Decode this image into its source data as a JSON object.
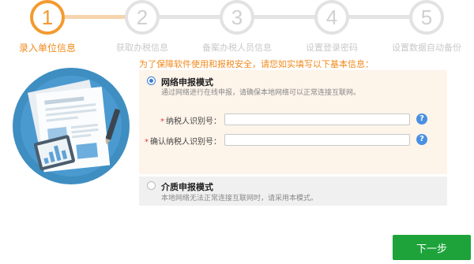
{
  "steps": [
    {
      "number": "1",
      "label": "录入单位信息"
    },
    {
      "number": "2",
      "label": "获取办税信息"
    },
    {
      "number": "3",
      "label": "备案办税人员信息"
    },
    {
      "number": "4",
      "label": "设置登录密码"
    },
    {
      "number": "5",
      "label": "设置数据自动备份"
    }
  ],
  "form": {
    "intro": "为了保障软件使用和报税安全，请您如实填写以下基本信息：",
    "network_mode": {
      "title": "网络申报模式",
      "desc": "通过网络进行在线申报，请确保本地网络可以正常连接互联网。"
    },
    "fields": {
      "tax_id_label": "纳税人识别号：",
      "tax_id_value": "",
      "confirm_tax_id_label": "确认纳税人识别号：",
      "confirm_tax_id_value": "",
      "required_mark": "*",
      "help": "?"
    },
    "media_mode": {
      "title": "介质申报模式",
      "desc": "本地网络无法正常连接互联网时，请采用本模式。"
    }
  },
  "next_label": "下一步",
  "colors": {
    "accent": "#f08a1c",
    "active_step": "#f39a2f",
    "next_button": "#1da33a",
    "radio": "#3b7dd8",
    "help_icon": "#4a90e2"
  },
  "icons": {
    "help": "question-circle-icon",
    "illustration": "document-chart-illustration"
  }
}
